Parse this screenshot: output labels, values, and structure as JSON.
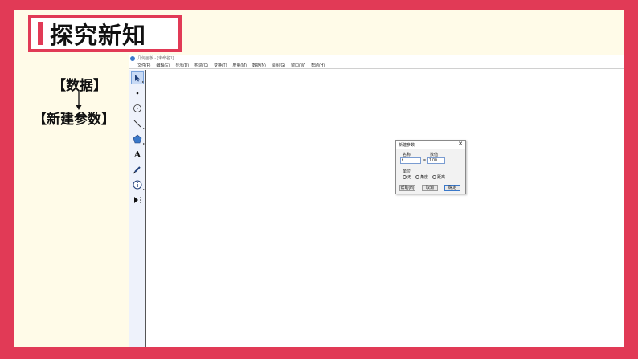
{
  "slide": {
    "title": "探究新知",
    "side_top": "【数据】",
    "side_bottom": "【新建参数】"
  },
  "app": {
    "window_title": "几何画板 - [未命名1]",
    "menu": [
      "文件(F)",
      "编辑(E)",
      "显示(D)",
      "构造(C)",
      "变换(T)",
      "度量(M)",
      "数据(N)",
      "绘图(G)",
      "窗口(W)",
      "帮助(H)"
    ],
    "tools": [
      "arrow",
      "point",
      "compass",
      "straightedge",
      "polygon",
      "text",
      "marker",
      "information",
      "custom"
    ],
    "text_tool_glyph": "A"
  },
  "dialog": {
    "title": "新建参数",
    "close_glyph": "✕",
    "name_label": "名称",
    "value_label": "数值",
    "name_value": "t",
    "equals": "=",
    "number_value": "1.00",
    "units_label": "单位",
    "units": [
      "无",
      "角度",
      "距离"
    ],
    "units_selected": 0,
    "help_button": "帮助(H)",
    "cancel_button": "取消",
    "ok_button": "确定"
  }
}
